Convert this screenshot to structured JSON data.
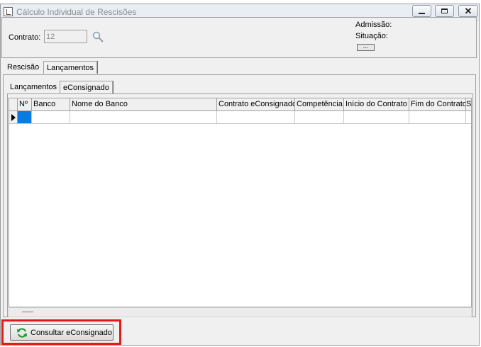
{
  "window": {
    "title": "Cálculo Individual de Rescisões"
  },
  "header": {
    "contrato_label": "Contrato:",
    "contrato_value": "12",
    "admissao_label": "Admissão:",
    "situacao_label": "Situação:",
    "dots_label": "..."
  },
  "tabs": [
    {
      "label": "Rescisão",
      "active": false
    },
    {
      "label": "Lançamentos",
      "active": true
    }
  ],
  "subtabs": [
    {
      "label": "Lançamentos",
      "active": false
    },
    {
      "label": "eConsignado",
      "active": true
    }
  ],
  "grid": {
    "columns": [
      "Nº",
      "Banco",
      "Nome do Banco",
      "Contrato eConsignado",
      "Competência",
      "Início do Contrato",
      "Fim do Contrato",
      "S"
    ]
  },
  "footer": {
    "consult_button_label": "Consultar eConsignado"
  },
  "colors": {
    "highlight": "#e21a1a",
    "selection": "#0a7bdf"
  }
}
